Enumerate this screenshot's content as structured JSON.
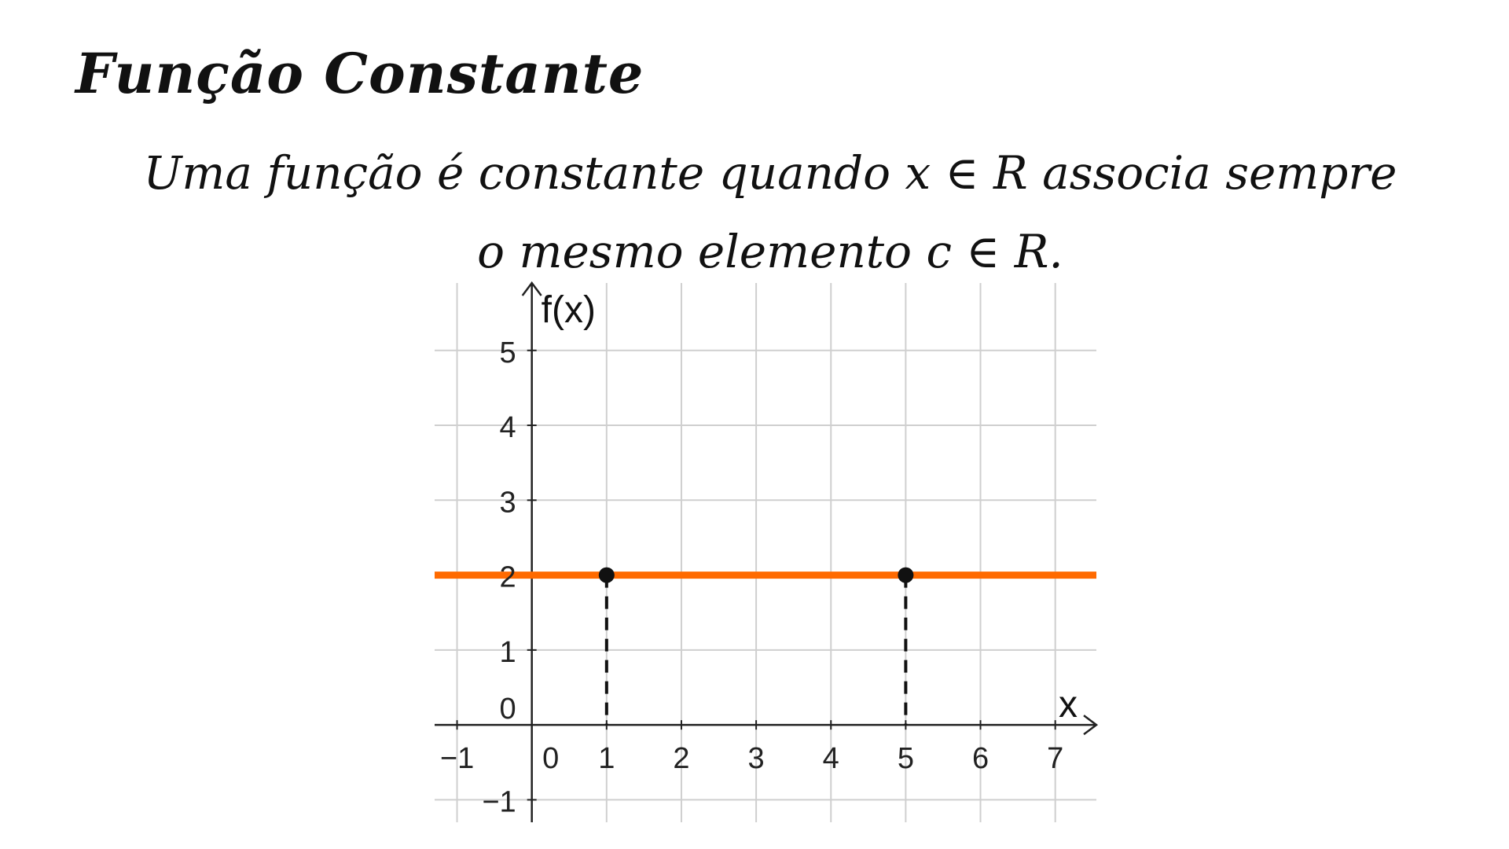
{
  "slide": {
    "title": "Função Constante",
    "definition_line1": "Uma função é constante quando  x ∈ R associa sempre",
    "definition_line2": "o mesmo elemento  c ∈ R."
  },
  "chart_data": {
    "type": "line",
    "xlabel": "x",
    "ylabel": "f(x)",
    "xlim": [
      -1.3,
      7.55
    ],
    "ylim": [
      -1.3,
      5.9
    ],
    "x_ticks": [
      -1,
      0,
      1,
      2,
      3,
      4,
      5,
      6,
      7
    ],
    "x_tick_labels": [
      "−1",
      "0",
      "1",
      "2",
      "3",
      "4",
      "5",
      "6",
      "7"
    ],
    "y_ticks": [
      -1,
      0,
      1,
      2,
      3,
      4,
      5
    ],
    "y_tick_labels": [
      "−1",
      "0",
      "1",
      "2",
      "3",
      "4",
      "5"
    ],
    "grid": true,
    "series": [
      {
        "constant_value": 2,
        "x_range": [
          -1.3,
          7.55
        ],
        "color": "#ff6a00"
      }
    ],
    "points": [
      {
        "x": 1,
        "y": 2
      },
      {
        "x": 5,
        "y": 2
      }
    ],
    "colors": {
      "grid": "#cfcfcf",
      "axis": "#222222",
      "function_line": "#ff6a00",
      "point": "#111111",
      "guide": "#111111"
    }
  }
}
